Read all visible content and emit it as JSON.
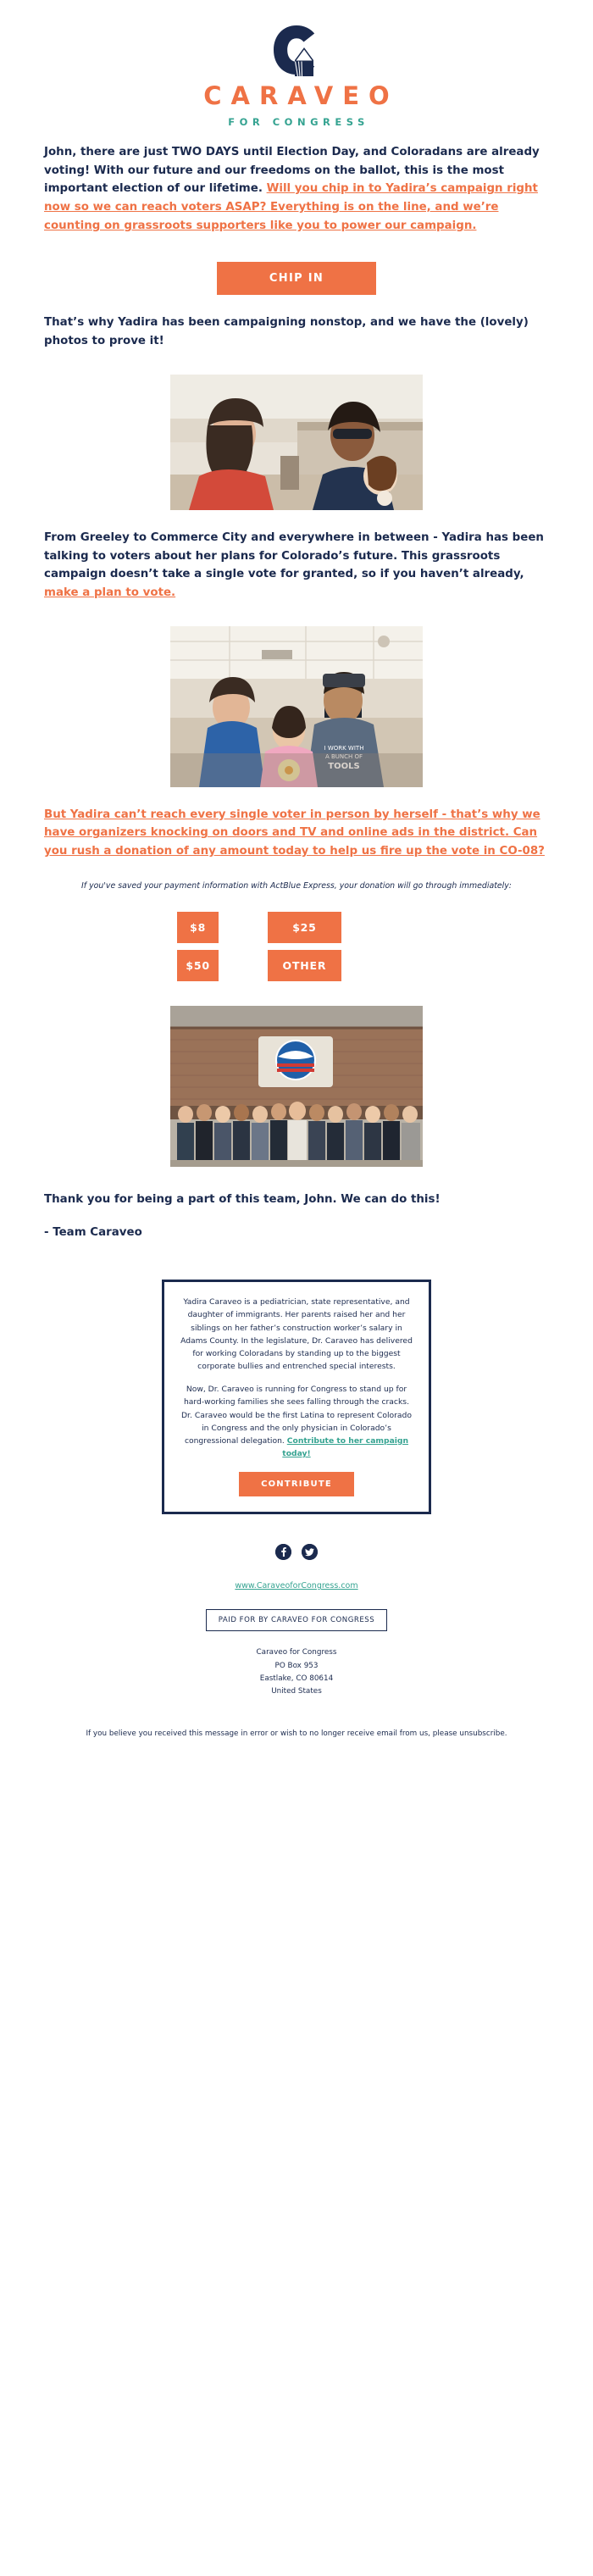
{
  "brand": {
    "logo_mark": "colorado-c-mountain-logo",
    "wordmark": "CARAVEO",
    "tagline": "FOR CONGRESS",
    "orange": "#ef7245",
    "navy": "#1b2a4e",
    "teal": "#35a391"
  },
  "intro": {
    "plain_1": "John, there are just TWO DAYS until Election Day, and Coloradans are already voting! With our future and our freedoms on the ballot, this is the most important election of our lifetime. ",
    "link_1": "Will you chip in to Yadira’s campaign right now so we can reach voters ASAP? Everything is on the line, and we’re counting on grassroots supporters like you to power our campaign."
  },
  "cta_primary": {
    "label": "CHIP IN"
  },
  "para_photos": "That’s why Yadira has been campaigning nonstop, and we have the (lovely) photos to prove it!",
  "para_greeley": {
    "plain": "From Greeley to Commerce City and everywhere in between - Yadira has been talking to voters about her plans for Colorado’s future. This grassroots campaign doesn’t take a single vote for granted, so if you haven’t already, ",
    "link": "make a plan to vote."
  },
  "para_orange": "But Yadira can’t reach every single voter in person by herself - that’s why we have organizers knocking on doors and TV and online ads in the district. Can you rush a donation of any amount today to help us fire up the vote in CO-08?",
  "donation": {
    "disclaimer": "If you've saved your payment information with ActBlue Express, your donation will go through immediately:",
    "amounts": [
      {
        "label": "$8"
      },
      {
        "label": "$25"
      },
      {
        "label": "$50"
      },
      {
        "label": "OTHER"
      }
    ]
  },
  "photos": [
    {
      "name": "photo-yadira-with-supporter",
      "alt": "Yadira Caraveo smiling with a supporter indoors"
    },
    {
      "name": "photo-yadira-with-family",
      "alt": "Yadira Caraveo with a family and child at a doorway"
    },
    {
      "name": "photo-campaign-group",
      "alt": "Large campaign volunteer group outside a brick building"
    }
  ],
  "closing": {
    "thanks": "Thank you for being a part of this team, John. We can do this!",
    "signature": "- Team Caraveo"
  },
  "bio": {
    "paragraph_1": "Yadira Caraveo is a pediatrician, state representative, and daughter of immigrants. Her parents raised her and her siblings on her father’s construction worker’s salary in Adams County. In the legislature, Dr. Caraveo has delivered for working Coloradans by standing up to the biggest corporate bullies and entrenched special interests.",
    "paragraph_2_plain": "Now, Dr. Caraveo is running for Congress to stand up for hard-working families she sees falling through the cracks. Dr. Caraveo would be the first Latina to represent Colorado in Congress and the only physician in Colorado’s congressional delegation. ",
    "paragraph_2_link": "Contribute to her campaign today!",
    "button_label": "CONTRIBUTE"
  },
  "footer": {
    "social": [
      {
        "name": "facebook-icon",
        "label": "Facebook"
      },
      {
        "name": "twitter-icon",
        "label": "Twitter"
      }
    ],
    "website": "www.CaraveoforCongress.com",
    "paid_for": "PAID FOR BY CARAVEO FOR CONGRESS",
    "address_lines": [
      "Caraveo for Congress",
      "PO Box 953",
      "Eastlake, CO 80614",
      "United States"
    ],
    "unsubscribe": "If you believe you received this message in error or wish to no longer receive email from us, please unsubscribe."
  }
}
